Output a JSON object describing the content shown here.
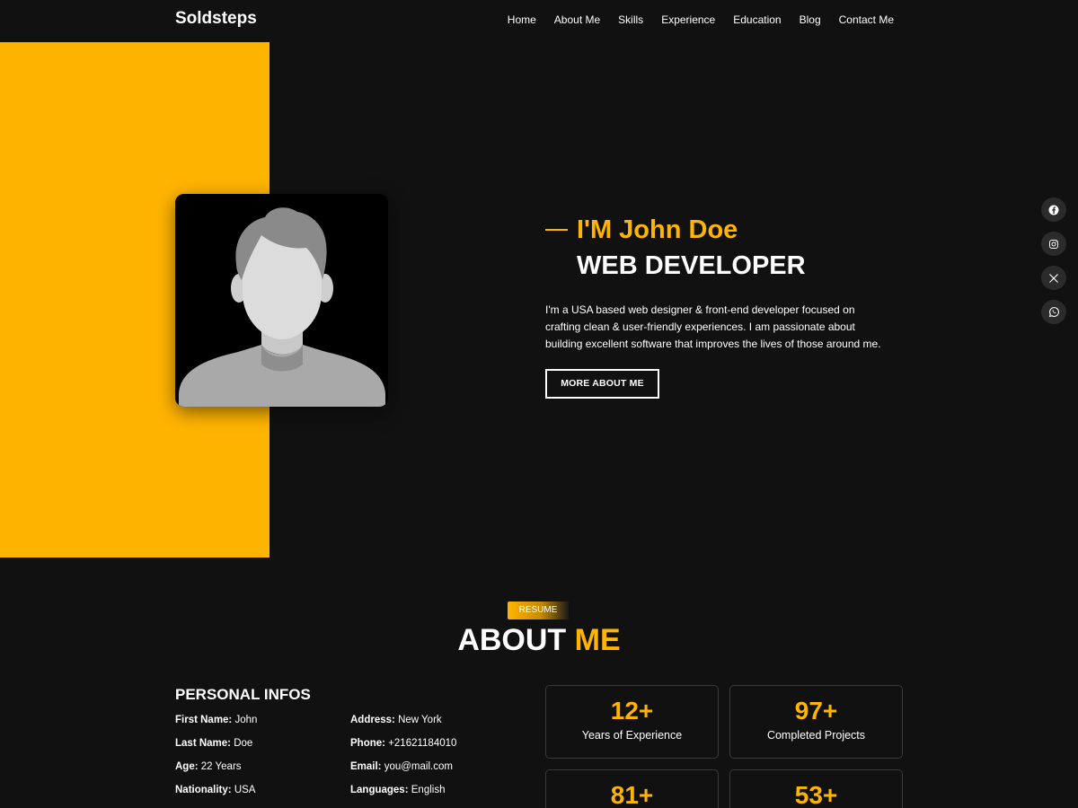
{
  "nav": {
    "brand": "Soldsteps",
    "links": [
      "Home",
      "About Me",
      "Skills",
      "Experience",
      "Education",
      "Blog",
      "Contact Me"
    ]
  },
  "hero": {
    "intro": "I'M John Doe",
    "role": "WEB DEVELOPER",
    "description": "I'm a USA based web designer & front-end developer focused on crafting clean & user-friendly experiences. I am passionate about building excellent software that improves the lives of those around me.",
    "button": "MORE ABOUT ME"
  },
  "socials": [
    "facebook-icon",
    "instagram-icon",
    "x-icon",
    "whatsapp-icon"
  ],
  "about": {
    "badge": "RESUME",
    "title_main": "ABOUT",
    "title_accent": "ME",
    "personal_title": "PERSONAL INFOS",
    "info": [
      {
        "label": "First Name:",
        "value": "John"
      },
      {
        "label": "Address:",
        "value": "New York"
      },
      {
        "label": "Last Name:",
        "value": "Doe"
      },
      {
        "label": "Phone:",
        "value": "+21621184010"
      },
      {
        "label": "Age:",
        "value": "22 Years"
      },
      {
        "label": "Email:",
        "value": "you@mail.com"
      },
      {
        "label": "Nationality:",
        "value": "USA"
      },
      {
        "label": "Languages:",
        "value": "English"
      }
    ],
    "stats": [
      {
        "number": "12+",
        "label": "Years of Experience"
      },
      {
        "number": "97+",
        "label": "Completed Projects"
      },
      {
        "number": "81+",
        "label": ""
      },
      {
        "number": "53+",
        "label": ""
      }
    ]
  },
  "colors": {
    "accent": "#FFB400",
    "background": "#111111"
  }
}
